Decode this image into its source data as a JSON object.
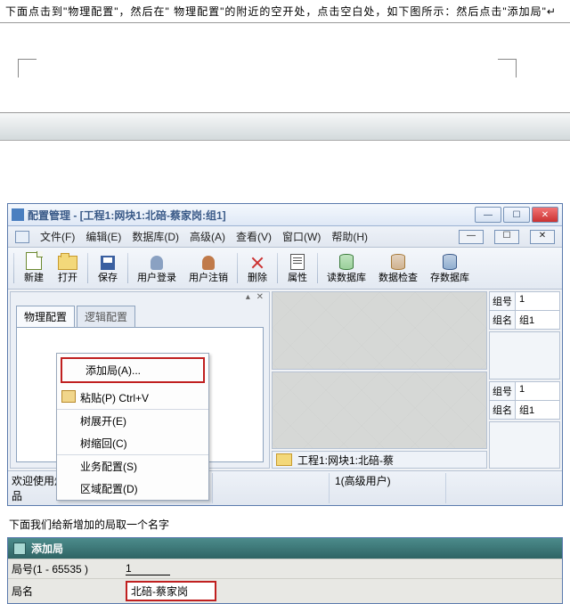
{
  "instr_top": "下面点击到\"物理配置\"，然后在\" 物理配置\"的附近的空开处，点击空白处，如下图所示：然后点击\"添加局\"↵",
  "window": {
    "title": "配置管理 - [工程1:网块1:北碚-蔡家岗:组1]",
    "sysmin": "—",
    "sysmax": "☐",
    "sysclose": "✕"
  },
  "menu": {
    "file": "文件(F)",
    "edit": "编辑(E)",
    "db": "数据库(D)",
    "adv": "高级(A)",
    "view": "查看(V)",
    "window": "窗口(W)",
    "help": "帮助(H)"
  },
  "toolbar": {
    "new": "新建",
    "open": "打开",
    "save": "保存",
    "login": "用户登录",
    "logout": "用户注销",
    "delete": "删除",
    "prop": "属性",
    "readdb": "读数据库",
    "checkdb": "数据检查",
    "savedb": "存数据库"
  },
  "left": {
    "tab_phys": "物理配置",
    "tab_logic": "逻辑配置"
  },
  "ctx": {
    "add": "添加局(A)...",
    "paste": "粘贴(P)  Ctrl+V",
    "expand": "树展开(E)",
    "collapse": "树缩回(C)",
    "svc": "业务配置(S)",
    "region": "区域配置(D)"
  },
  "mid_status": "工程1:网块1:北碚-蔡",
  "right": {
    "label1": "组号",
    "val1": "1",
    "label2": "组名",
    "val2": "组1"
  },
  "status": {
    "welcome": "欢迎使用烽火通信科技股份有限公司的产品",
    "user": "1(高级用户)"
  },
  "para2": "下面我们给新增加的局取一个名字",
  "dialog": {
    "title": "添加局",
    "row1_label": "局号(1 - 65535 )",
    "row1_val": "1",
    "row2_label": "局名",
    "row2_val": "北碚-蔡家岗"
  }
}
